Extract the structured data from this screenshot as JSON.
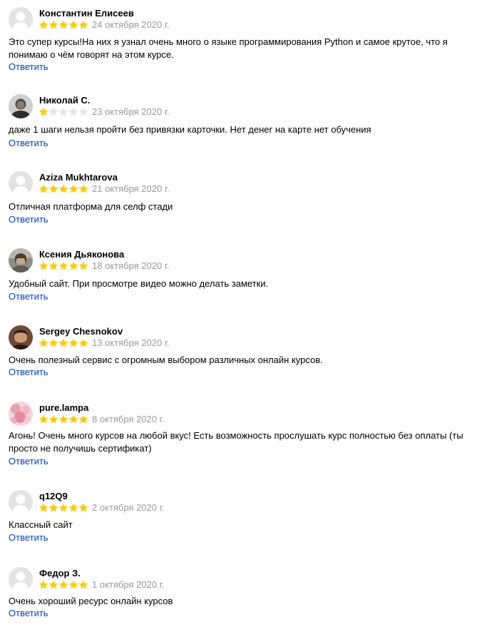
{
  "reply_label": "Ответить",
  "colors": {
    "star_filled": "#ffcc00",
    "star_empty": "#e5e5e5",
    "date": "#999999",
    "link": "#0044bb"
  },
  "reviews": [
    {
      "author": "Константин Елисеев",
      "rating": 5,
      "date": "24 октября 2020 г.",
      "text": "Это супер курсы!На них я узнал очень много о языке программирования Python и самое крутое, что я понимаю о чём говорят на этом курсе.",
      "avatar": "default-avatar-icon"
    },
    {
      "author": "Николай С.",
      "rating": 1,
      "date": "23 октября 2020 г.",
      "text": "даже 1 шаги нельзя пройти без привязки карточки. Нет денег на карте нет обучения",
      "avatar": "user-photo"
    },
    {
      "author": "Aziza Mukhtarova",
      "rating": 5,
      "date": "21 октября 2020 г.",
      "text": "Отличная платформа для селф стади",
      "avatar": "default-avatar-icon"
    },
    {
      "author": "Ксения Дьяконова",
      "rating": 5,
      "date": "18 октября 2020 г.",
      "text": "Удобный сайт. При просмотре видео можно делать заметки.",
      "avatar": "user-photo"
    },
    {
      "author": "Sergey Chesnokov",
      "rating": 5,
      "date": "13 октября 2020 г.",
      "text": "Очень полезный сервис с огромным выбором различных онлайн курсов.",
      "avatar": "user-photo"
    },
    {
      "author": "pure.lampa",
      "rating": 5,
      "date": "8 октября 2020 г.",
      "text": "Агонь! Очень много курсов на любой вкус! Есть возможность прослушать курс полностью без оплаты (ты просто не получишь сертификат)",
      "avatar": "user-photo"
    },
    {
      "author": "q12Q9",
      "rating": 5,
      "date": "2 октября 2020 г.",
      "text": "Классный сайт",
      "avatar": "default-avatar-icon"
    },
    {
      "author": "Федор З.",
      "rating": 5,
      "date": "1 октября 2020 г.",
      "text": "Очень хороший ресурс онлайн курсов",
      "avatar": "default-avatar-icon"
    }
  ]
}
